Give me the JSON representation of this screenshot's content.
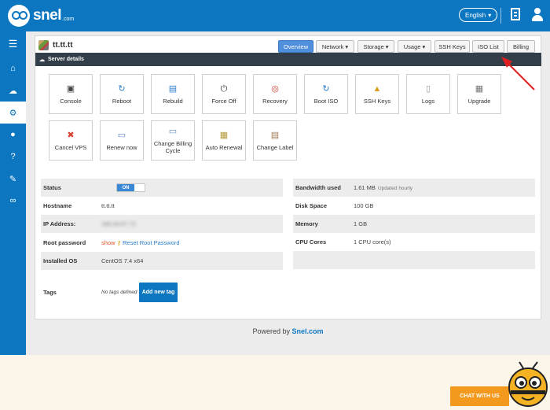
{
  "brand": {
    "name": "snel",
    "tld": ".com"
  },
  "header": {
    "language": "English",
    "language_caret": "▾"
  },
  "server": {
    "name": "tt.tt.tt"
  },
  "tabs": [
    {
      "label": "Overview",
      "caret": ""
    },
    {
      "label": "Network",
      "caret": "▾"
    },
    {
      "label": "Storage",
      "caret": "▾"
    },
    {
      "label": "Usage",
      "caret": "▾"
    },
    {
      "label": "SSH Keys",
      "caret": ""
    },
    {
      "label": "ISO List",
      "caret": ""
    },
    {
      "label": "Billing",
      "caret": ""
    }
  ],
  "section": {
    "title": "Server details"
  },
  "actions": [
    {
      "label": "Console",
      "icon": "console-icon",
      "glyph": "▣",
      "color": "#444"
    },
    {
      "label": "Reboot",
      "icon": "reboot-icon",
      "glyph": "↻",
      "color": "#2a7dc9"
    },
    {
      "label": "Rebuild",
      "icon": "rebuild-icon",
      "glyph": "▤",
      "color": "#2a7dc9"
    },
    {
      "label": "Force Off",
      "icon": "power-icon",
      "glyph": "⏻",
      "color": "#444"
    },
    {
      "label": "Recovery",
      "icon": "lifebuoy-icon",
      "glyph": "◎",
      "color": "#d8402f"
    },
    {
      "label": "Boot ISO",
      "icon": "boot-iso-icon",
      "glyph": "↻",
      "color": "#2a7dc9"
    },
    {
      "label": "SSH Keys",
      "icon": "lock-icon",
      "glyph": "▲",
      "color": "#d5a21e"
    },
    {
      "label": "Logs",
      "icon": "logs-icon",
      "glyph": "▯",
      "color": "#999"
    },
    {
      "label": "Upgrade",
      "icon": "upgrade-icon",
      "glyph": "▦",
      "color": "#777"
    },
    {
      "label": "Cancel VPS",
      "icon": "cancel-icon",
      "glyph": "✖",
      "color": "#d8402f"
    },
    {
      "label": "Renew now",
      "icon": "renew-icon",
      "glyph": "▭",
      "color": "#5a88b8"
    },
    {
      "label": "Change Billing Cycle",
      "icon": "billing-cycle-icon",
      "glyph": "▭",
      "color": "#5a88b8"
    },
    {
      "label": "Auto Renewal",
      "icon": "auto-renewal-icon",
      "glyph": "▦",
      "color": "#b59a3a"
    },
    {
      "label": "Change Label",
      "icon": "label-icon",
      "glyph": "▤",
      "color": "#a07850"
    }
  ],
  "details_left": {
    "status_label": "Status",
    "status_value": "ON",
    "hostname_label": "Hostname",
    "hostname_value": "tt.tt.tt",
    "ip_label": "IP Address:",
    "ip_value": "185.44.67.72",
    "root_label": "Root password",
    "root_show": "show",
    "root_reset": "Reset Root Password",
    "os_label": "Installed OS",
    "os_value": "CentOS 7.4 x64",
    "tags_label": "Tags",
    "tags_value": "No tags defined",
    "add_tag": "Add new tag"
  },
  "details_right": {
    "bw_label": "Bandwidth used",
    "bw_value": "1.61 MB",
    "bw_note": "Updated hourly",
    "disk_label": "Disk Space",
    "disk_value": "100 GB",
    "mem_label": "Memory",
    "mem_value": "1 GB",
    "cpu_label": "CPU Cores",
    "cpu_value": "1 CPU core(s)"
  },
  "footer": {
    "prefix": "Powered by",
    "brand": "Snel.com"
  },
  "chat": {
    "label": "CHAT WITH US"
  },
  "colors": {
    "brand_blue": "#0c77c0",
    "dark_header": "#323f4b",
    "chat_orange": "#f39a1e",
    "tab_active": "#4f8fdc"
  }
}
